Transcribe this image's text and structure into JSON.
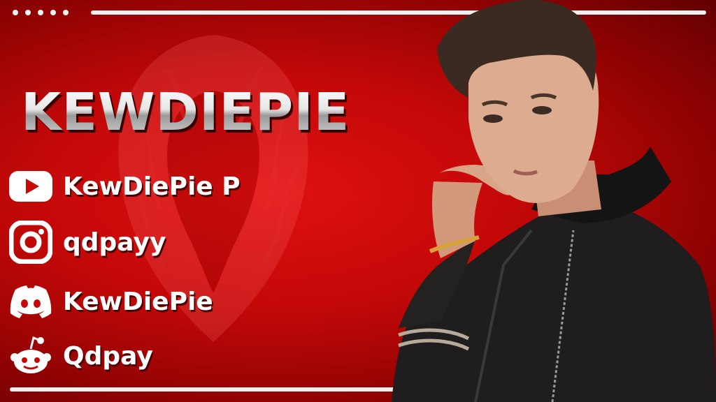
{
  "banner": {
    "title": "KEWDIEPIE",
    "socials": [
      {
        "platform_icon": "youtube-icon",
        "handle": "KewDiePie P"
      },
      {
        "platform_icon": "instagram-icon",
        "handle": "qdpayy"
      },
      {
        "platform_icon": "discord-icon",
        "handle": "KewDiePie"
      },
      {
        "platform_icon": "reddit-icon",
        "handle": "Qdpay"
      }
    ],
    "colors": {
      "background": "#c80808",
      "accent": "#ffffff",
      "shadow": "#4a0000"
    }
  }
}
